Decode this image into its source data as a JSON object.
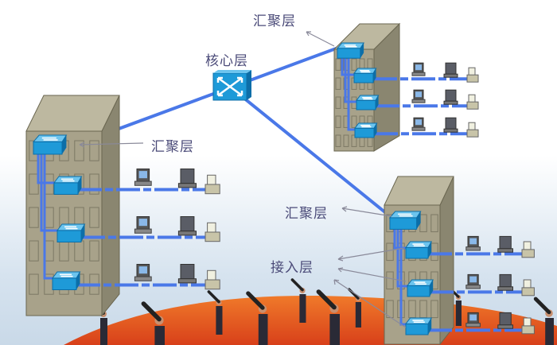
{
  "labels": {
    "core": "核心层",
    "distribution_top": "汇聚层",
    "distribution_left": "汇聚层",
    "distribution_right": "汇聚层",
    "access": "接入层"
  },
  "colors": {
    "link": "#4a78e8",
    "switch": "#1e9ad8",
    "building_front": "#a8a28a",
    "building_side": "#8a8670",
    "ground": "#e8561e",
    "sky": "#dfe9f2"
  }
}
